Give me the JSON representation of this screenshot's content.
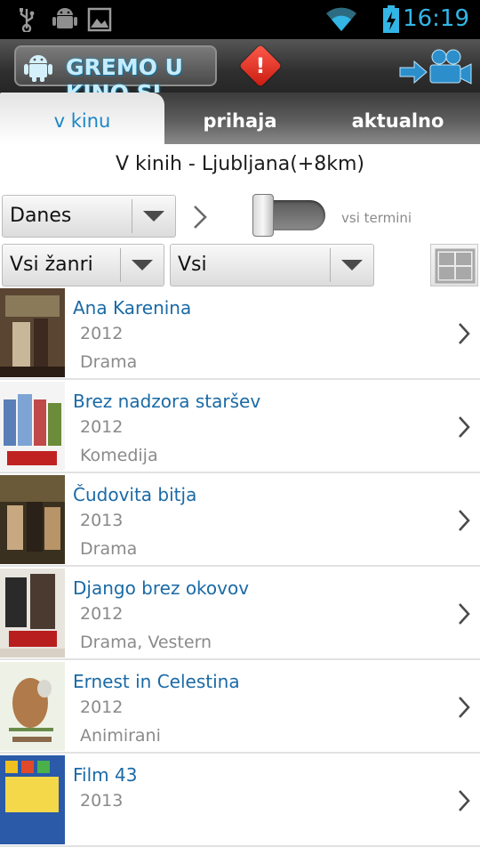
{
  "status_bar": {
    "time": "16:19",
    "icons": [
      "usb-icon",
      "android-debug-icon",
      "image-icon",
      "wifi-icon",
      "battery-charging-icon"
    ]
  },
  "header": {
    "logo_text": "GREMO U KINO.SI",
    "alert_symbol": "!",
    "colors": {
      "logo_text": "#c6ecfa",
      "alert": "#d9251a",
      "accent": "#1a86c8"
    }
  },
  "tabs": [
    {
      "label": "v kinu",
      "active": true
    },
    {
      "label": "prihaja",
      "active": false
    },
    {
      "label": "aktualno",
      "active": false
    }
  ],
  "subtitle": "V kinih - Ljubljana(+8km)",
  "filters": {
    "day": "Danes",
    "toggle_label": "vsi termini",
    "toggle_on": false,
    "genre": "Vsi žanri",
    "type": "Vsi"
  },
  "movies": [
    {
      "title": "Ana Karenina",
      "year": "2012",
      "genre": "Drama"
    },
    {
      "title": "Brez nadzora staršev",
      "year": "2012",
      "genre": "Komedija"
    },
    {
      "title": "Čudovita bitja",
      "year": "2013",
      "genre": "Drama"
    },
    {
      "title": "Django brez okovov",
      "year": "2012",
      "genre": "Drama, Vestern"
    },
    {
      "title": "Ernest in Celestina",
      "year": "2012",
      "genre": "Animirani"
    },
    {
      "title": "Film 43",
      "year": "2013",
      "genre": ""
    }
  ]
}
